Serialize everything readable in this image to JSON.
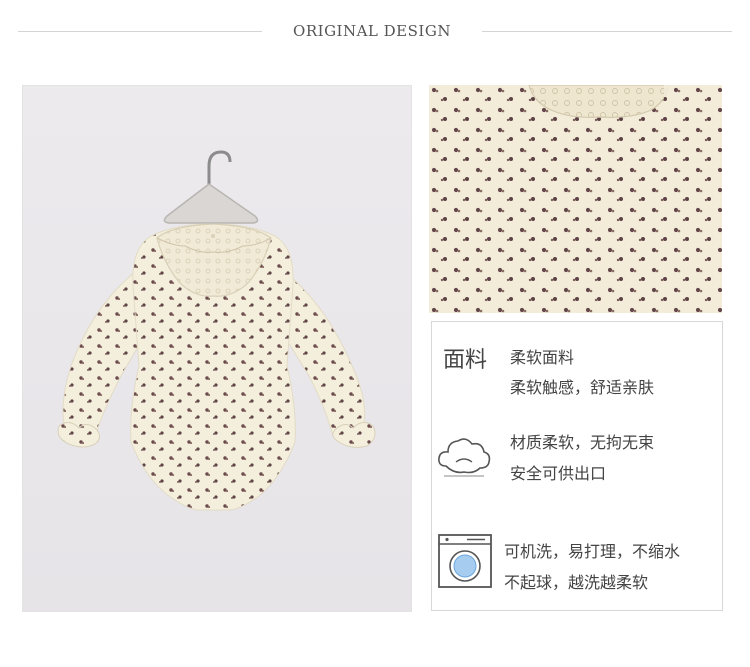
{
  "header": {
    "title": "ORIGINAL DESIGN"
  },
  "images": {
    "main": "product-photo-bodysuit-on-hanger",
    "detail": "fabric-print-detail-closeup"
  },
  "features": [
    {
      "icon": "fabric-label",
      "label": "面料",
      "lines": [
        "柔软面料",
        "柔软触感，舒适亲肤"
      ]
    },
    {
      "icon": "cloud-icon",
      "lines": [
        "材质柔软，无拘无束",
        "安全可供出口"
      ]
    },
    {
      "icon": "washing-machine-icon",
      "lines": [
        "可机洗，易打理，不缩水",
        "不起球，越洗越柔软"
      ]
    }
  ]
}
